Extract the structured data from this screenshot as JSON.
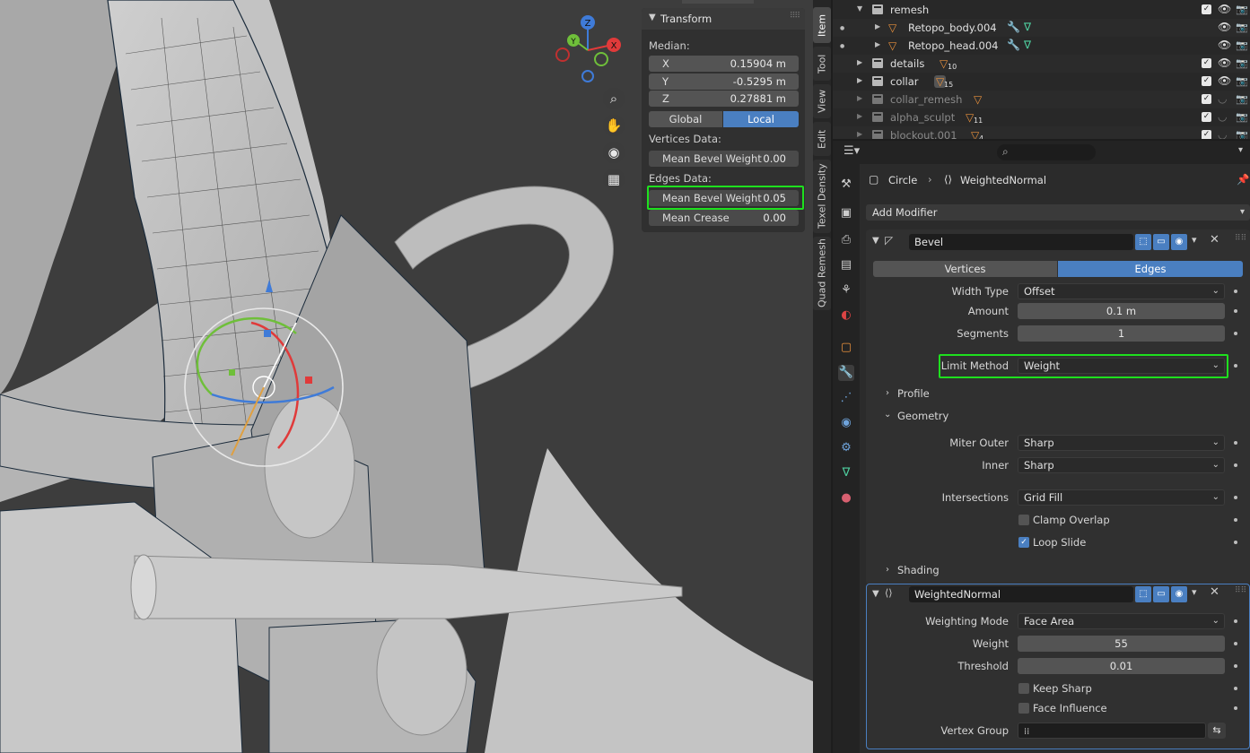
{
  "npanel": {
    "title": "Transform",
    "median_label": "Median:",
    "x_label": "X",
    "x_value": "0.15904 m",
    "y_label": "Y",
    "y_value": "-0.5295 m",
    "z_label": "Z",
    "z_value": "0.27881 m",
    "global_label": "Global",
    "local_label": "Local",
    "vertices_data_label": "Vertices Data:",
    "vert_bevel_label": "Mean Bevel Weight",
    "vert_bevel_value": "0.00",
    "edges_data_label": "Edges Data:",
    "edge_bevel_label": "Mean Bevel Weight",
    "edge_bevel_value": "0.05",
    "crease_label": "Mean Crease",
    "crease_value": "0.00"
  },
  "tabs": [
    "Item",
    "Tool",
    "View",
    "Edit",
    "Texel Density",
    "Quad Remesh"
  ],
  "gizmo": {
    "x": "X",
    "y": "Y",
    "z": "Z"
  },
  "outliner": {
    "rows": [
      {
        "name": "remesh",
        "badge": ""
      },
      {
        "name": "Retopo_body.004",
        "badge": ""
      },
      {
        "name": "Retopo_head.004",
        "badge": ""
      },
      {
        "name": "details",
        "badge": "10"
      },
      {
        "name": "collar",
        "badge": "15"
      },
      {
        "name": "collar_remesh",
        "badge": ""
      },
      {
        "name": "alpha_sculpt",
        "badge": "11"
      },
      {
        "name": "blockout.001",
        "badge": "4"
      }
    ]
  },
  "properties": {
    "breadcrumb_object": "Circle",
    "breadcrumb_modifier": "WeightedNormal",
    "add_modifier": "Add Modifier",
    "bevel": {
      "name": "Bevel",
      "tab_vertices": "Vertices",
      "tab_edges": "Edges",
      "width_type_label": "Width Type",
      "width_type_value": "Offset",
      "amount_label": "Amount",
      "amount_value": "0.1 m",
      "segments_label": "Segments",
      "segments_value": "1",
      "limit_method_label": "Limit Method",
      "limit_method_value": "Weight",
      "profile_label": "Profile",
      "geometry_label": "Geometry",
      "miter_outer_label": "Miter Outer",
      "miter_outer_value": "Sharp",
      "inner_label": "Inner",
      "inner_value": "Sharp",
      "intersections_label": "Intersections",
      "intersections_value": "Grid Fill",
      "clamp_overlap_label": "Clamp Overlap",
      "loop_slide_label": "Loop Slide",
      "shading_label": "Shading"
    },
    "weighted_normal": {
      "name": "WeightedNormal",
      "weighting_mode_label": "Weighting Mode",
      "weighting_mode_value": "Face Area",
      "weight_label": "Weight",
      "weight_value": "55",
      "threshold_label": "Threshold",
      "threshold_value": "0.01",
      "keep_sharp_label": "Keep Sharp",
      "face_influence_label": "Face Influence",
      "vertex_group_label": "Vertex Group"
    }
  },
  "colors": {
    "highlight": "#1ee01e",
    "accent": "#4a7fc1"
  }
}
